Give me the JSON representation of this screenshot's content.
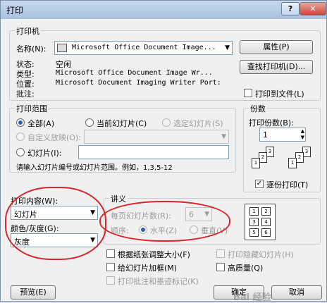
{
  "window": {
    "title": "打印",
    "help_glyph": "?",
    "close_glyph": "✕"
  },
  "printer": {
    "group_title": "打印机",
    "name_label": "名称(N):",
    "name_value": "Microsoft Office Document Image...",
    "status_label": "状态:",
    "status_value": "空闲",
    "type_label": "类型:",
    "type_value": "Microsoft Office Document Image Wr...",
    "location_label": "位置:",
    "location_value": "Microsoft Document Imaging Writer Port:",
    "comment_label": "批注:",
    "properties_button": "属性(P)",
    "find_button": "查找打印机(D)...",
    "print_to_file": "打印到文件(L)"
  },
  "range": {
    "group_title": "打印范围",
    "all": "全部(A)",
    "current": "当前幻灯片(C)",
    "selection": "选定幻灯片(S)",
    "custom": "自定义放映(O):",
    "slides": "幻灯片(I):",
    "hint": "请输入幻灯片编号或幻灯片范围。例如，1,3,5-12"
  },
  "copies": {
    "group_title": "份数",
    "count_label": "打印份数(B):",
    "count_value": "1",
    "collate": "逐份打印(T)",
    "page_numbers": [
      "1",
      "2",
      "3",
      "1",
      "2",
      "3"
    ]
  },
  "content": {
    "print_what_label": "打印内容(W):",
    "print_what_value": "幻灯片",
    "color_label": "颜色/灰度(G):",
    "color_value": "灰度"
  },
  "handouts": {
    "group_title": "讲义",
    "per_page_label": "每页幻灯片数(R):",
    "per_page_value": "6",
    "order_label": "顺序:",
    "horizontal": "水平(Z)",
    "vertical": "垂直(V)",
    "grid_numbers": [
      "1",
      "2",
      "3",
      "4",
      "5",
      "6"
    ]
  },
  "options": {
    "scale": "根据纸张调整大小(F)",
    "frame": "给幻灯片加框(M)",
    "comments": "打印批注和墨迹标记(K)",
    "hidden": "打印隐藏幻灯片(H)",
    "high_quality": "高质量(Q)"
  },
  "footer": {
    "preview": "预览(E)",
    "ok": "确定",
    "cancel": "取消"
  },
  "watermark": "Bai 经验"
}
